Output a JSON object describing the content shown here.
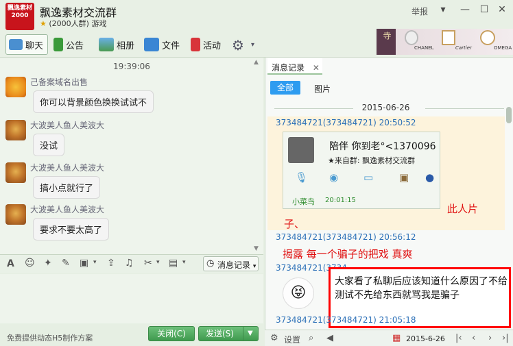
{
  "window": {
    "logo_text": "飄逸素材 2000",
    "title": "飘逸素材交流群",
    "subtitle": "(2000人群) 游戏",
    "report": "举报",
    "min": "—",
    "max": "☐",
    "close": "✕"
  },
  "toolbar": {
    "chat": "聊天",
    "announce": "公告",
    "album": "相册",
    "files": "文件",
    "activity": "活动"
  },
  "ad": {
    "brand1": "CHANEL",
    "brand2": "Cartier",
    "brand3": "OMEGA"
  },
  "chat": {
    "time": "19:39:06",
    "messages": [
      {
        "sender": "己备案域名出售",
        "text": "你可以背景颜色换换试试不"
      },
      {
        "sender": "大波美人鱼人美波大",
        "text": "没试"
      },
      {
        "sender": "大波美人鱼人美波大",
        "text": "搞小点就行了"
      },
      {
        "sender": "大波美人鱼人美波大",
        "text": "要求不要太高了"
      }
    ]
  },
  "input": {
    "history_button": "消息记录",
    "footer_text": "免费提供动态H5制作方案",
    "close_button": "关闭(C)",
    "send_button": "发送(S)"
  },
  "history": {
    "tab": "消息记录",
    "filter_all": "全部",
    "filter_images": "图片",
    "date": "2015-06-26",
    "entries": [
      {
        "sender": "373484721(373484721) 20:50:52"
      },
      {
        "sender": "373484721(373484721) 20:56:12",
        "text": "揭露 每一个骗子的把戏  真爽"
      },
      {
        "sender": "373484721(373484721) 21:05:18"
      }
    ],
    "card": {
      "title": "陪伴 你到老°<1370096",
      "from": "★来自群: 飘逸素材交流群",
      "user": "小菜鸟",
      "time": "20:01:15"
    },
    "red_text_1": "此人片",
    "red_text_2": "子、",
    "overlap_sender": "373484721(3734",
    "highlight_text": "大家看了私聊后应该知道什么原因了不给测试不先给东西就骂我是骗子",
    "footer_settings": "设置",
    "footer_date": "2015-6-26"
  },
  "colors": {
    "accent": "#2e9cf0",
    "send_green": "#3f9a4e",
    "highlight_red": "#ff0000",
    "sender_blue": "#2a6fb7"
  }
}
